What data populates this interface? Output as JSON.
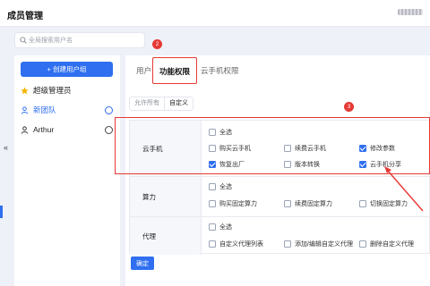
{
  "header": {
    "title": "成员管理"
  },
  "search": {
    "placeholder": "全局搜索用户名",
    "value": ""
  },
  "annotations": {
    "badge_2": "2",
    "badge_3": "3"
  },
  "sidebar": {
    "create_button": "+ 创建用户组",
    "groups": [
      {
        "label": "超级管理员",
        "icon": "star-icon",
        "active": false
      },
      {
        "label": "新团队",
        "icon": "person-icon",
        "active": true
      },
      {
        "label": "Arthur",
        "icon": "person-icon",
        "active": false
      }
    ]
  },
  "tabs": [
    {
      "label": "用户",
      "active": false
    },
    {
      "label": "功能权限",
      "active": true
    },
    {
      "label": "云手机权限",
      "active": false
    }
  ],
  "segment": {
    "options": [
      "允许所有",
      "自定义"
    ],
    "selected": "自定义"
  },
  "permissions": [
    {
      "label": "云手机",
      "options": [
        {
          "label": "全选",
          "checked": false
        },
        {
          "label": "购买云手机",
          "checked": false
        },
        {
          "label": "续费云手机",
          "checked": false
        },
        {
          "label": "修改参数",
          "checked": true
        },
        {
          "label": "恢复出厂",
          "checked": true
        },
        {
          "label": "版本转换",
          "checked": false
        },
        {
          "label": "云手机分享",
          "checked": true
        }
      ]
    },
    {
      "label": "算力",
      "options": [
        {
          "label": "全选",
          "checked": false
        },
        {
          "label": "购买固定算力",
          "checked": false
        },
        {
          "label": "续费固定算力",
          "checked": false
        },
        {
          "label": "切换固定算力",
          "checked": false
        }
      ]
    },
    {
      "label": "代理",
      "options": [
        {
          "label": "全选",
          "checked": false
        },
        {
          "label": "自定义代理列表",
          "checked": false
        },
        {
          "label": "添加/编辑自定义代理",
          "checked": false
        },
        {
          "label": "删除自定义代理",
          "checked": false
        }
      ]
    }
  ],
  "footer": {
    "confirm_label": "确定"
  },
  "collapse_glyph": "«",
  "colors": {
    "primary": "#2f6ff0",
    "annotation_red": "#e53935"
  }
}
